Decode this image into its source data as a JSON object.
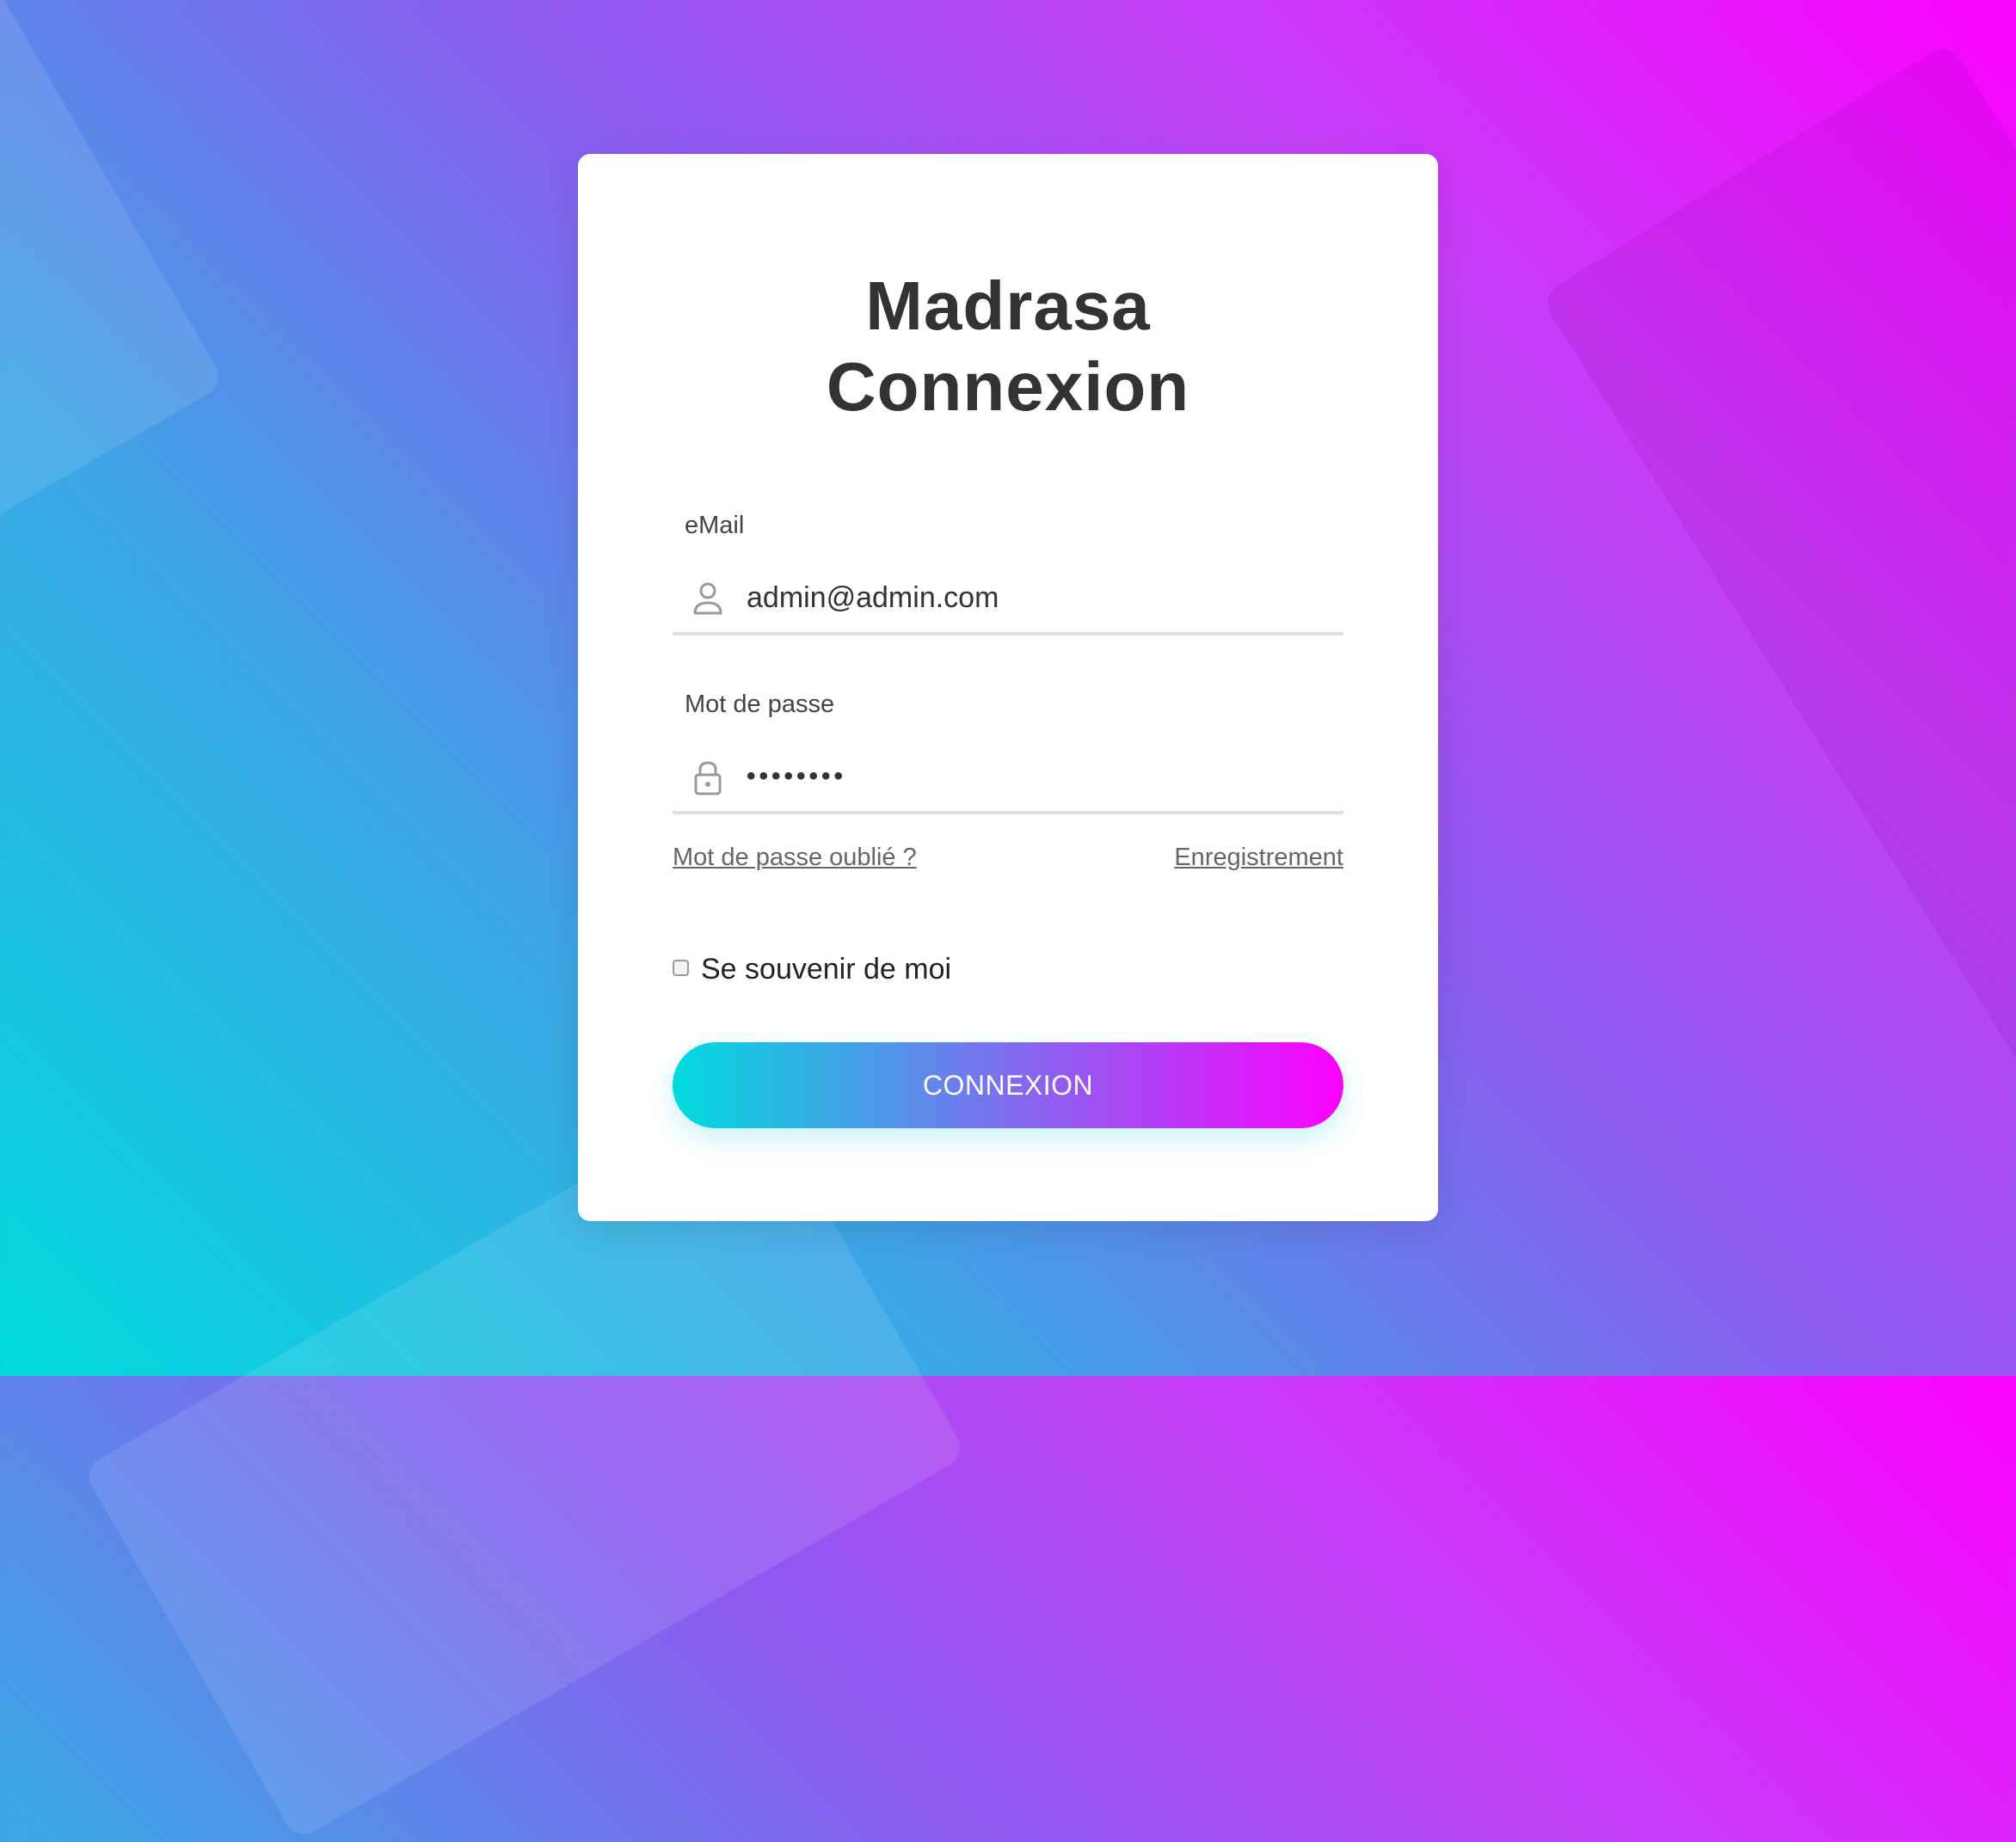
{
  "title": {
    "line1": "Madrasa",
    "line2": "Connexion"
  },
  "email": {
    "label": "eMail",
    "value": "admin@admin.com",
    "icon": "user-icon"
  },
  "password": {
    "label": "Mot de passe",
    "value": "••••••••",
    "icon": "lock-icon"
  },
  "links": {
    "forgot": "Mot de passe oublié ?",
    "register": "Enregistrement"
  },
  "remember": {
    "label": "Se souvenir de moi",
    "checked": false
  },
  "submit": {
    "label": "CONNEXION"
  },
  "colors": {
    "gradient_start": "#00dbde",
    "gradient_end": "#fc00ff",
    "title": "#333333",
    "underline": "#e0e0e0"
  }
}
